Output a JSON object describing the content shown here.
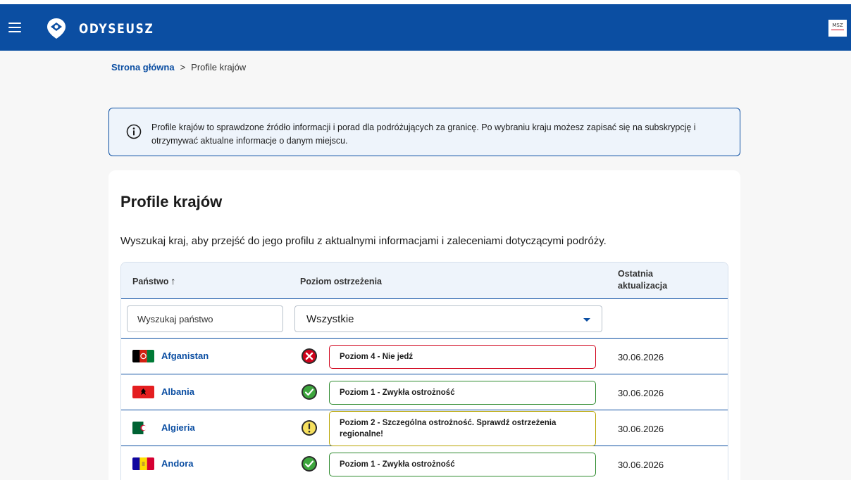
{
  "header": {
    "brand": "ODYSEUSZ",
    "menu_icon": "hamburger-icon",
    "logo_icon": "location-pin-icon",
    "ministry_logo_text": "MSZ",
    "brand_color": "#0b4ea2"
  },
  "breadcrumb": {
    "home": "Strona główna",
    "separator": ">",
    "current": "Profile krajów"
  },
  "info_box": {
    "icon": "info-icon",
    "text": "Profile krajów to sprawdzone źródło informacji i porad dla podróżujących za granicę. Po wybraniu kraju możesz zapisać się na subskrypcję i otrzymywać aktualne informacje o danym miejscu."
  },
  "main": {
    "title": "Profile krajów",
    "description": "Wyszukaj kraj, aby przejść do jego profilu z aktualnymi informacjami i zaleceniami dotyczącymi podróży.",
    "table": {
      "col_country": "Państwo",
      "col_country_sort": "↑",
      "col_level": "Poziom ostrzeżenia",
      "col_date_line1": "Ostatnia",
      "col_date_line2": "aktualizacja",
      "search_placeholder": "Wyszukaj państwo",
      "filter_value": "Wszystkie",
      "rows": [
        {
          "country": "Afganistan",
          "flag": "flag-afghanistan",
          "status": "danger",
          "level": "Poziom 4 - Nie jedź",
          "border_color": "#d0021b",
          "date": "30.06.2026"
        },
        {
          "country": "Albania",
          "flag": "flag-albania",
          "status": "ok",
          "level": "Poziom 1 - Zwykła ostrożność",
          "border_color": "#2e8b2e",
          "date": "30.06.2026"
        },
        {
          "country": "Algieria",
          "flag": "flag-algeria",
          "status": "warning",
          "level": "Poziom 2 - Szczególna ostrożność. Sprawdź ostrzeżenia regionalne!",
          "border_color": "#b8a400",
          "date": "30.06.2026"
        },
        {
          "country": "Andora",
          "flag": "flag-andorra",
          "status": "ok",
          "level": "Poziom 1 - Zwykła ostrożność",
          "border_color": "#2e8b2e",
          "date": "30.06.2026"
        }
      ]
    }
  }
}
